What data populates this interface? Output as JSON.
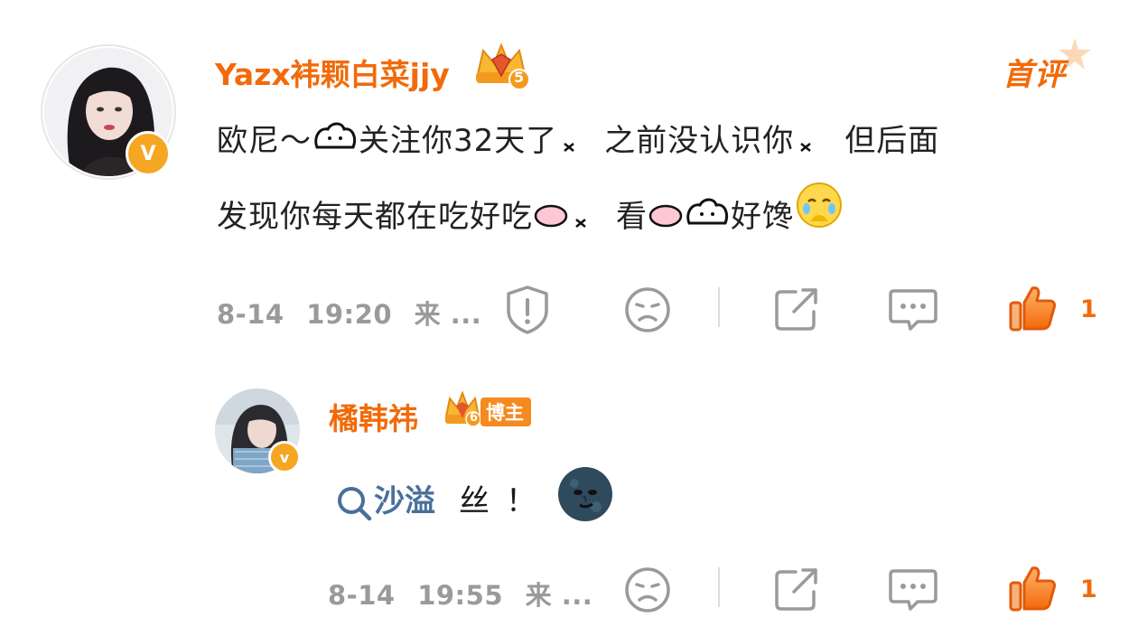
{
  "comment": {
    "username": "Yazx袆颗白菜jjy",
    "level": "5",
    "first_badge": "首评",
    "text_part1": "欧尼～",
    "text_part2": "关注你32天了",
    "text_part3": "之前没认识你",
    "text_part4": "但后面",
    "text_line2_part1": "发现你每天都在吃好吃",
    "text_line2_part2": "看",
    "text_line2_part3": "好馋",
    "date": "8-14",
    "time": "19:20",
    "source": "来 ...",
    "like_count": "1"
  },
  "reply": {
    "username": "橘韩祎",
    "level": "6",
    "author_tag": "博主",
    "search_term": "沙溢",
    "text": "丝！",
    "date": "8-14",
    "time": "19:55",
    "source": "来 ...",
    "like_count": "1"
  },
  "colors": {
    "accent": "#f26a0a",
    "meta": "#9a9a9a",
    "link": "#4a6f9c",
    "badge": "#f5a623"
  },
  "icons": [
    "report-icon",
    "dislike-face-icon",
    "share-icon",
    "comment-icon",
    "like-thumb-icon",
    "search-icon"
  ]
}
